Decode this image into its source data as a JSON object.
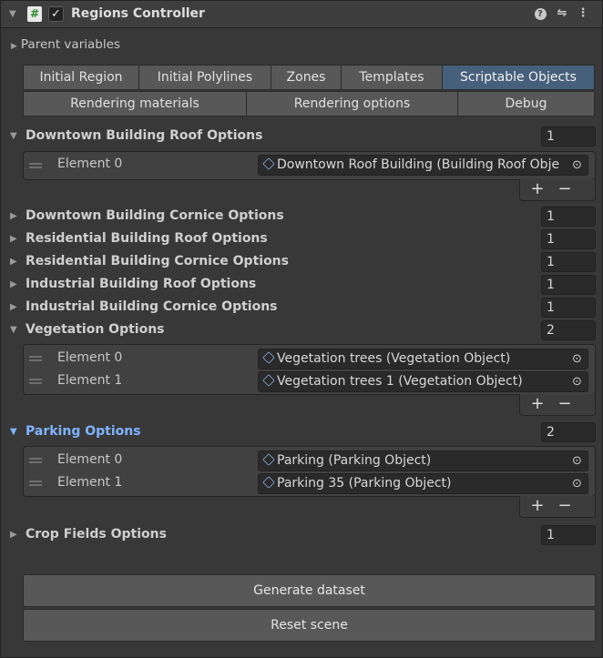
{
  "header": {
    "title": "Regions Controller",
    "script_icon_glyph": "#",
    "enabled_check_glyph": "✓",
    "help_glyph": "?",
    "presets_glyph": "⇋",
    "menu_glyph": "⋮"
  },
  "parent_variables_label": "Parent variables",
  "tabs_row1": [
    "Initial Region",
    "Initial Polylines",
    "Zones",
    "Templates",
    "Scriptable Objects"
  ],
  "tabs_row2": [
    "Rendering materials",
    "Rendering options",
    "Debug"
  ],
  "active_tab": "Scriptable Objects",
  "lists": {
    "downtown_roof": {
      "label": "Downtown Building Roof Options",
      "size": "1",
      "items": [
        {
          "label": "Element 0",
          "value": "Downtown Roof Building (Building Roof Obje"
        }
      ]
    },
    "downtown_cornice": {
      "label": "Downtown Building Cornice Options",
      "size": "1"
    },
    "residential_roof": {
      "label": "Residential Building Roof Options",
      "size": "1"
    },
    "residential_cornice": {
      "label": "Residential Building Cornice Options",
      "size": "1"
    },
    "industrial_roof": {
      "label": "Industrial Building Roof Options",
      "size": "1"
    },
    "industrial_cornice": {
      "label": "Industrial Building Cornice Options",
      "size": "1"
    },
    "vegetation": {
      "label": "Vegetation Options",
      "size": "2",
      "items": [
        {
          "label": "Element 0",
          "value": "Vegetation trees (Vegetation Object)"
        },
        {
          "label": "Element 1",
          "value": "Vegetation trees 1 (Vegetation Object)"
        }
      ]
    },
    "parking": {
      "label": "Parking Options",
      "size": "2",
      "items": [
        {
          "label": "Element 0",
          "value": "Parking (Parking Object)"
        },
        {
          "label": "Element 1",
          "value": "Parking 35 (Parking Object)"
        }
      ]
    },
    "crop_fields": {
      "label": "Crop Fields Options",
      "size": "1"
    }
  },
  "plus_glyph": "+",
  "minus_glyph": "−",
  "target_glyph": "⊙",
  "expanded_arrow": "▼",
  "collapsed_arrow": "▶",
  "buttons": {
    "generate": "Generate dataset",
    "reset": "Reset scene"
  },
  "colors": {
    "active_tab": "#46607c",
    "focused_label": "#7fb3ff"
  }
}
